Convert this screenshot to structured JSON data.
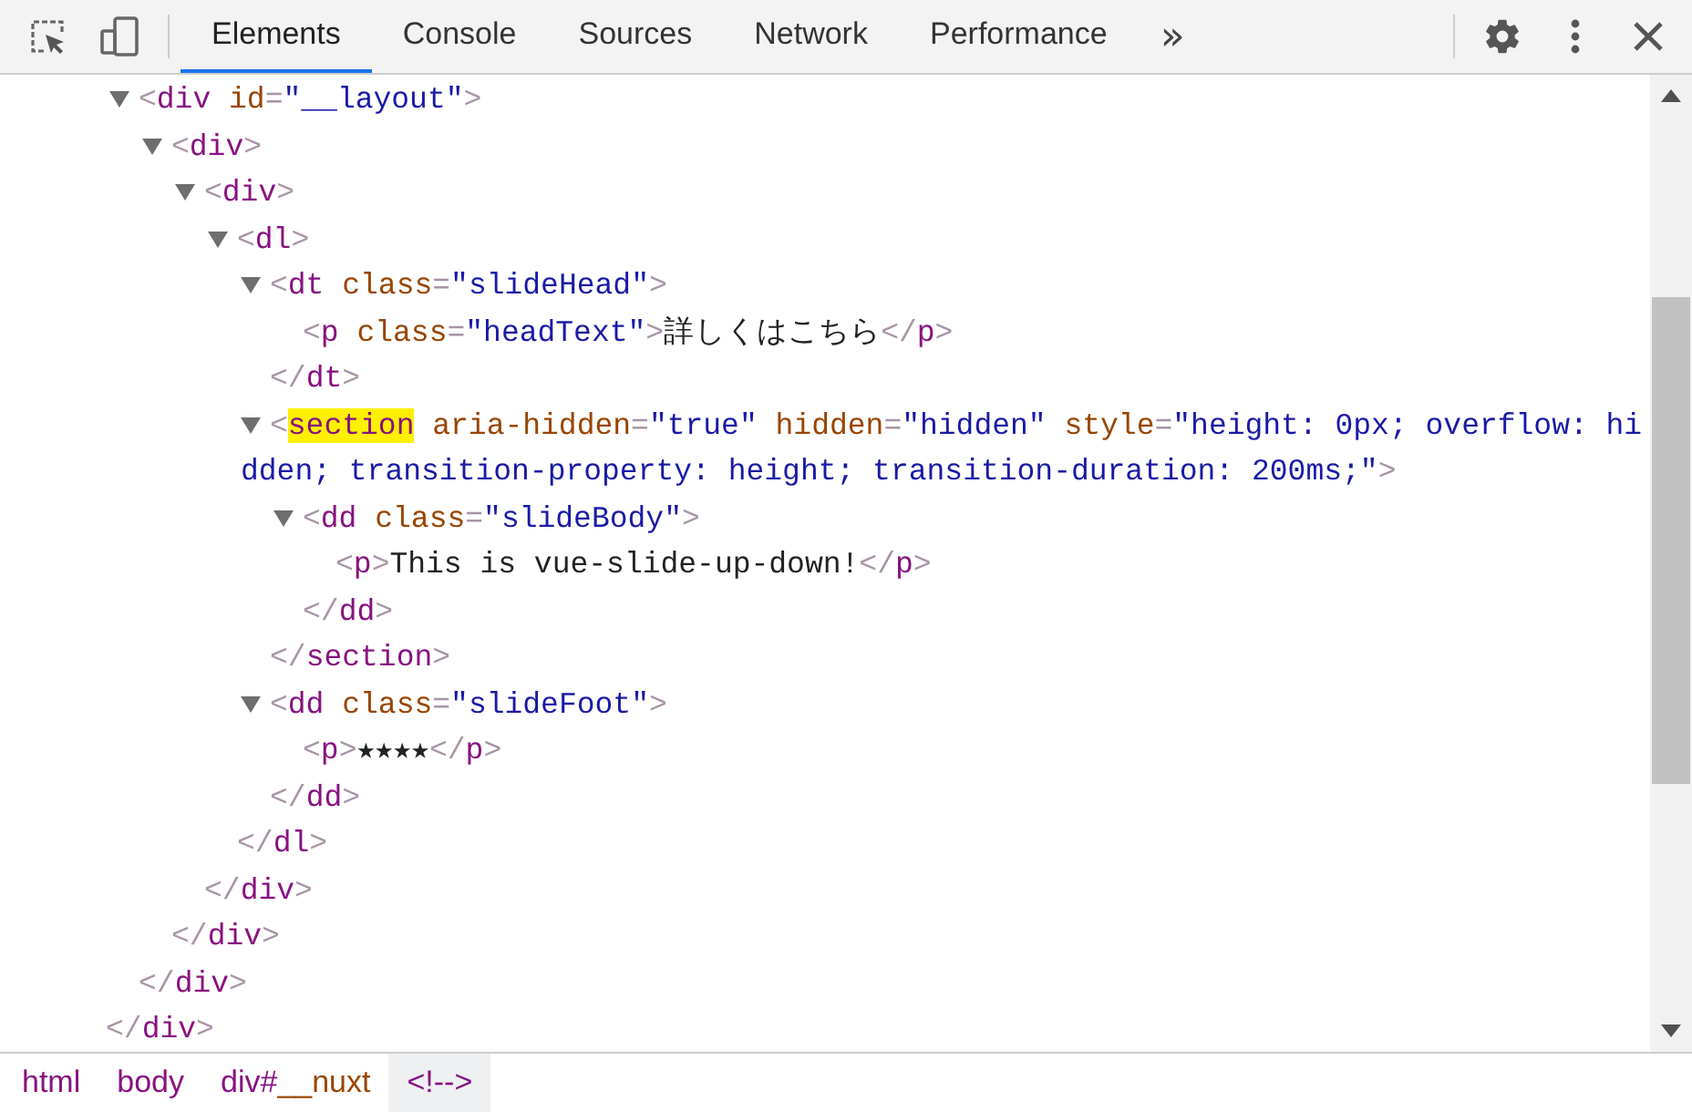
{
  "tabs": [
    {
      "label": "Elements",
      "selected": true
    },
    {
      "label": "Console",
      "selected": false
    },
    {
      "label": "Sources",
      "selected": false
    },
    {
      "label": "Network",
      "selected": false
    },
    {
      "label": "Performance",
      "selected": false
    }
  ],
  "more_tabs": "»",
  "dom_tree": {
    "children": [
      {
        "line": [
          {
            "kind": "punct",
            "text": "<"
          },
          {
            "kind": "tag",
            "text": "div"
          },
          {
            "kind": "attr",
            "text": " id"
          },
          {
            "kind": "punct",
            "text": "="
          },
          {
            "kind": "value",
            "text": "\"__layout\""
          },
          {
            "kind": "punct",
            "text": ">"
          }
        ],
        "expanded": true,
        "children": [
          {
            "line": [
              {
                "kind": "punct",
                "text": "<"
              },
              {
                "kind": "tag",
                "text": "div"
              },
              {
                "kind": "punct",
                "text": ">"
              }
            ],
            "expanded": true,
            "children": [
              {
                "line": [
                  {
                    "kind": "punct",
                    "text": "<"
                  },
                  {
                    "kind": "tag",
                    "text": "div"
                  },
                  {
                    "kind": "punct",
                    "text": ">"
                  }
                ],
                "expanded": true,
                "children": [
                  {
                    "line": [
                      {
                        "kind": "punct",
                        "text": "<"
                      },
                      {
                        "kind": "tag",
                        "text": "dl"
                      },
                      {
                        "kind": "punct",
                        "text": ">"
                      }
                    ],
                    "expanded": true,
                    "children": [
                      {
                        "line": [
                          {
                            "kind": "punct",
                            "text": "<"
                          },
                          {
                            "kind": "tag",
                            "text": "dt"
                          },
                          {
                            "kind": "attr",
                            "text": " class"
                          },
                          {
                            "kind": "punct",
                            "text": "="
                          },
                          {
                            "kind": "value",
                            "text": "\"slideHead\""
                          },
                          {
                            "kind": "punct",
                            "text": ">"
                          }
                        ],
                        "expanded": true,
                        "children": [
                          {
                            "line": [
                              {
                                "kind": "punct",
                                "text": "<"
                              },
                              {
                                "kind": "tag",
                                "text": "p"
                              },
                              {
                                "kind": "attr",
                                "text": " class"
                              },
                              {
                                "kind": "punct",
                                "text": "="
                              },
                              {
                                "kind": "value",
                                "text": "\"headText\""
                              },
                              {
                                "kind": "punct",
                                "text": ">"
                              },
                              {
                                "kind": "text",
                                "text": "詳しくはこちら"
                              },
                              {
                                "kind": "punct",
                                "text": "</"
                              },
                              {
                                "kind": "tag",
                                "text": "p"
                              },
                              {
                                "kind": "punct",
                                "text": ">"
                              }
                            ]
                          }
                        ],
                        "close": [
                          {
                            "kind": "punct",
                            "text": "</"
                          },
                          {
                            "kind": "tag",
                            "text": "dt"
                          },
                          {
                            "kind": "punct",
                            "text": ">"
                          }
                        ]
                      },
                      {
                        "line": [
                          {
                            "kind": "punct",
                            "text": "<"
                          },
                          {
                            "kind": "mark",
                            "text": "section"
                          },
                          {
                            "kind": "attr",
                            "text": " aria-hidden"
                          },
                          {
                            "kind": "punct",
                            "text": "="
                          },
                          {
                            "kind": "value",
                            "text": "\"true\""
                          },
                          {
                            "kind": "attr",
                            "text": " hidden"
                          },
                          {
                            "kind": "punct",
                            "text": "="
                          },
                          {
                            "kind": "value",
                            "text": "\"hidden\""
                          },
                          {
                            "kind": "attr",
                            "text": " style"
                          },
                          {
                            "kind": "punct",
                            "text": "="
                          },
                          {
                            "kind": "value",
                            "text": "\"height: 0px; overflow: hidden; transition-property: height; transition-duration: 200ms;\""
                          },
                          {
                            "kind": "punct",
                            "text": ">"
                          }
                        ],
                        "expanded": true,
                        "children": [
                          {
                            "line": [
                              {
                                "kind": "punct",
                                "text": "<"
                              },
                              {
                                "kind": "tag",
                                "text": "dd"
                              },
                              {
                                "kind": "attr",
                                "text": " class"
                              },
                              {
                                "kind": "punct",
                                "text": "="
                              },
                              {
                                "kind": "value",
                                "text": "\"slideBody\""
                              },
                              {
                                "kind": "punct",
                                "text": ">"
                              }
                            ],
                            "expanded": true,
                            "children": [
                              {
                                "line": [
                                  {
                                    "kind": "punct",
                                    "text": "<"
                                  },
                                  {
                                    "kind": "tag",
                                    "text": "p"
                                  },
                                  {
                                    "kind": "punct",
                                    "text": ">"
                                  },
                                  {
                                    "kind": "text",
                                    "text": "This is vue-slide-up-down!"
                                  },
                                  {
                                    "kind": "punct",
                                    "text": "</"
                                  },
                                  {
                                    "kind": "tag",
                                    "text": "p"
                                  },
                                  {
                                    "kind": "punct",
                                    "text": ">"
                                  }
                                ]
                              }
                            ],
                            "close": [
                              {
                                "kind": "punct",
                                "text": "</"
                              },
                              {
                                "kind": "tag",
                                "text": "dd"
                              },
                              {
                                "kind": "punct",
                                "text": ">"
                              }
                            ]
                          }
                        ],
                        "close": [
                          {
                            "kind": "punct",
                            "text": "</"
                          },
                          {
                            "kind": "tag",
                            "text": "section"
                          },
                          {
                            "kind": "punct",
                            "text": ">"
                          }
                        ]
                      },
                      {
                        "line": [
                          {
                            "kind": "punct",
                            "text": "<"
                          },
                          {
                            "kind": "tag",
                            "text": "dd"
                          },
                          {
                            "kind": "attr",
                            "text": " class"
                          },
                          {
                            "kind": "punct",
                            "text": "="
                          },
                          {
                            "kind": "value",
                            "text": "\"slideFoot\""
                          },
                          {
                            "kind": "punct",
                            "text": ">"
                          }
                        ],
                        "expanded": true,
                        "children": [
                          {
                            "line": [
                              {
                                "kind": "punct",
                                "text": "<"
                              },
                              {
                                "kind": "tag",
                                "text": "p"
                              },
                              {
                                "kind": "punct",
                                "text": ">"
                              },
                              {
                                "kind": "text",
                                "text": "★★★★"
                              },
                              {
                                "kind": "punct",
                                "text": "</"
                              },
                              {
                                "kind": "tag",
                                "text": "p"
                              },
                              {
                                "kind": "punct",
                                "text": ">"
                              }
                            ]
                          }
                        ],
                        "close": [
                          {
                            "kind": "punct",
                            "text": "</"
                          },
                          {
                            "kind": "tag",
                            "text": "dd"
                          },
                          {
                            "kind": "punct",
                            "text": ">"
                          }
                        ]
                      }
                    ],
                    "close": [
                      {
                        "kind": "punct",
                        "text": "</"
                      },
                      {
                        "kind": "tag",
                        "text": "dl"
                      },
                      {
                        "kind": "punct",
                        "text": ">"
                      }
                    ]
                  }
                ],
                "close": [
                  {
                    "kind": "punct",
                    "text": "</"
                  },
                  {
                    "kind": "tag",
                    "text": "div"
                  },
                  {
                    "kind": "punct",
                    "text": ">"
                  }
                ]
              }
            ],
            "close": [
              {
                "kind": "punct",
                "text": "</"
              },
              {
                "kind": "tag",
                "text": "div"
              },
              {
                "kind": "punct",
                "text": ">"
              }
            ]
          }
        ],
        "close": [
          {
            "kind": "punct",
            "text": "</"
          },
          {
            "kind": "tag",
            "text": "div"
          },
          {
            "kind": "punct",
            "text": ">"
          }
        ]
      }
    ],
    "close": [
      {
        "kind": "punct",
        "text": "</"
      },
      {
        "kind": "tag",
        "text": "div"
      },
      {
        "kind": "punct",
        "text": ">"
      }
    ]
  },
  "breadcrumbs": [
    {
      "parts": [
        {
          "kind": "tag",
          "text": "html"
        }
      ],
      "selected": false
    },
    {
      "parts": [
        {
          "kind": "tag",
          "text": "body"
        }
      ],
      "selected": false
    },
    {
      "parts": [
        {
          "kind": "tag",
          "text": "div#"
        },
        {
          "kind": "id",
          "text": "__nuxt"
        }
      ],
      "selected": false
    },
    {
      "parts": [
        {
          "kind": "punct",
          "text": "<!-->"
        }
      ],
      "selected": true
    }
  ]
}
